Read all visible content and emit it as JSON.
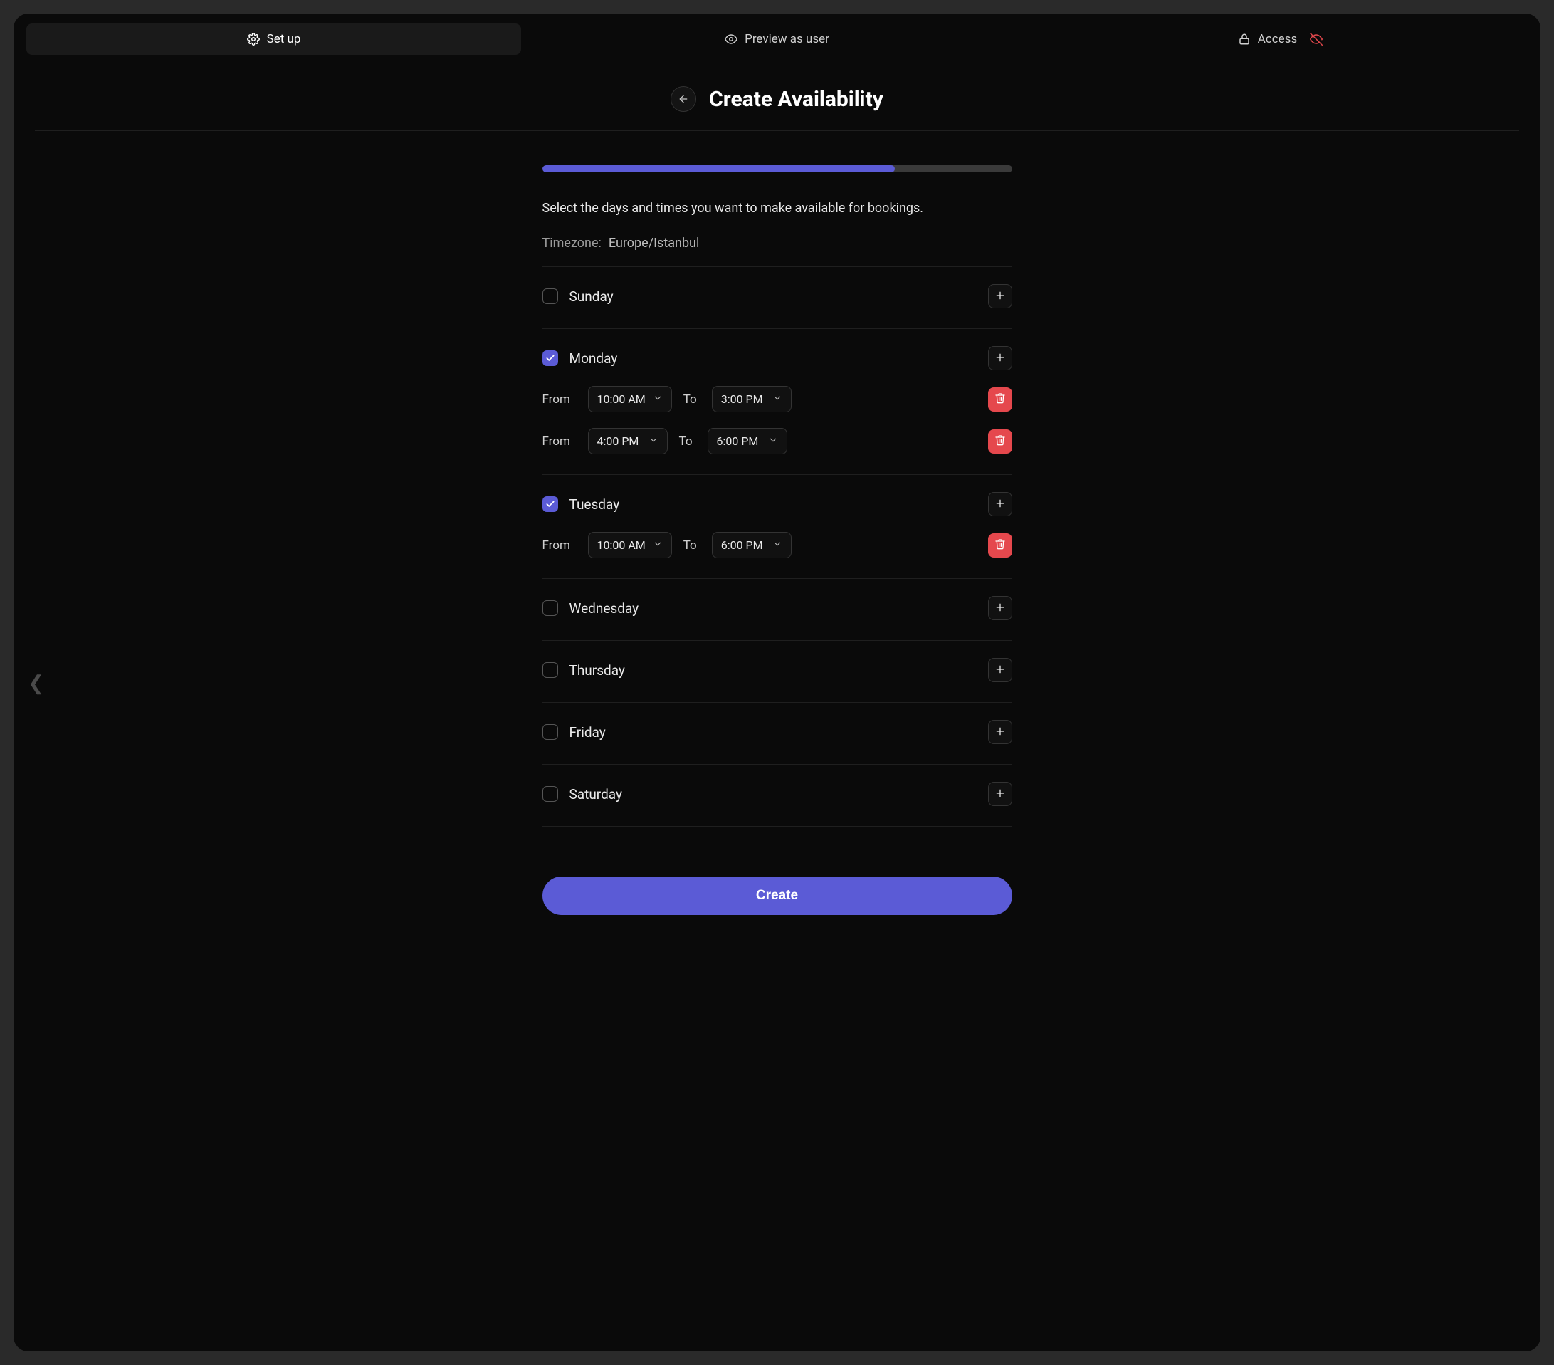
{
  "tabs": {
    "setup": "Set up",
    "preview": "Preview as user",
    "access": "Access"
  },
  "header": {
    "title": "Create Availability"
  },
  "progress": {
    "percent": 75
  },
  "instructions": "Select the days and times you want to make available for bookings.",
  "timezone": {
    "label": "Timezone:",
    "value": "Europe/Istanbul"
  },
  "labels": {
    "from": "From",
    "to": "To"
  },
  "days": [
    {
      "name": "Sunday",
      "checked": false,
      "slots": []
    },
    {
      "name": "Monday",
      "checked": true,
      "slots": [
        {
          "from": "10:00 AM",
          "to": "3:00 PM"
        },
        {
          "from": "4:00 PM",
          "to": "6:00 PM"
        }
      ]
    },
    {
      "name": "Tuesday",
      "checked": true,
      "slots": [
        {
          "from": "10:00 AM",
          "to": "6:00 PM"
        }
      ]
    },
    {
      "name": "Wednesday",
      "checked": false,
      "slots": []
    },
    {
      "name": "Thursday",
      "checked": false,
      "slots": []
    },
    {
      "name": "Friday",
      "checked": false,
      "slots": []
    },
    {
      "name": "Saturday",
      "checked": false,
      "slots": []
    }
  ],
  "buttons": {
    "create": "Create"
  }
}
